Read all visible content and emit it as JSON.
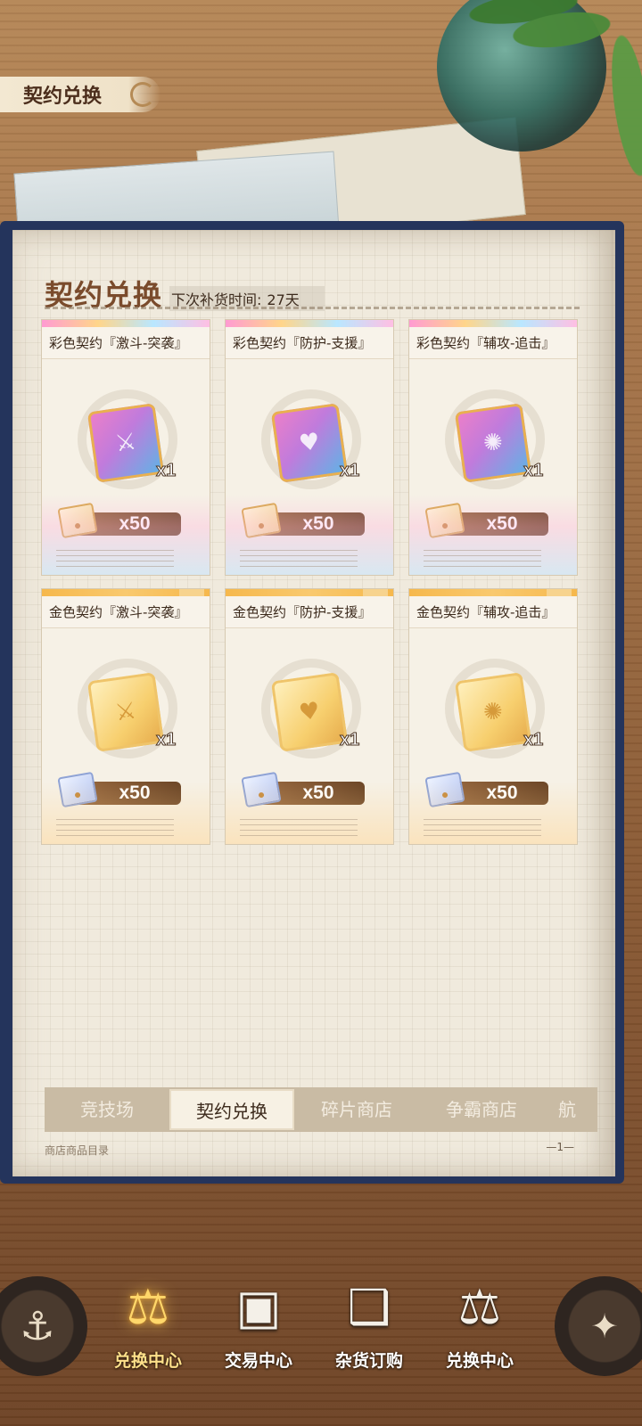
{
  "header": {
    "title": "契约兑换"
  },
  "section": {
    "title": "契约兑换",
    "restock_label": "下次补货时间:",
    "restock_value": "27天"
  },
  "items": [
    {
      "name": "彩色契约『激斗-突袭』",
      "qty": "x1",
      "cost": "x50",
      "tier": "rainbow"
    },
    {
      "name": "彩色契约『防护-支援』",
      "qty": "x1",
      "cost": "x50",
      "tier": "rainbow"
    },
    {
      "name": "彩色契约『辅攻-追击』",
      "qty": "x1",
      "cost": "x50",
      "tier": "rainbow"
    },
    {
      "name": "金色契约『激斗-突袭』",
      "qty": "x1",
      "cost": "x50",
      "tier": "gold"
    },
    {
      "name": "金色契约『防护-支援』",
      "qty": "x1",
      "cost": "x50",
      "tier": "gold"
    },
    {
      "name": "金色契约『辅攻-追击』",
      "qty": "x1",
      "cost": "x50",
      "tier": "gold"
    }
  ],
  "tabs": [
    {
      "label": "竞技场",
      "active": false
    },
    {
      "label": "契约兑换",
      "active": true
    },
    {
      "label": "碎片商店",
      "active": false
    },
    {
      "label": "争霸商店",
      "active": false
    },
    {
      "label": "航",
      "active": false
    }
  ],
  "footer": {
    "catalog": "商店商品目录",
    "page": "—1—"
  },
  "nav": [
    {
      "label": "兑换中心",
      "icon": "scales-icon",
      "active": true
    },
    {
      "label": "交易中心",
      "icon": "chest-icon",
      "active": false
    },
    {
      "label": "杂货订购",
      "icon": "book-icon",
      "active": false
    },
    {
      "label": "兑换中心",
      "icon": "scales-star-icon",
      "active": false
    }
  ],
  "colors": {
    "accent_gold": "#ffd76a",
    "title_brown": "#7a4b2c",
    "book_blue": "#24345c"
  }
}
